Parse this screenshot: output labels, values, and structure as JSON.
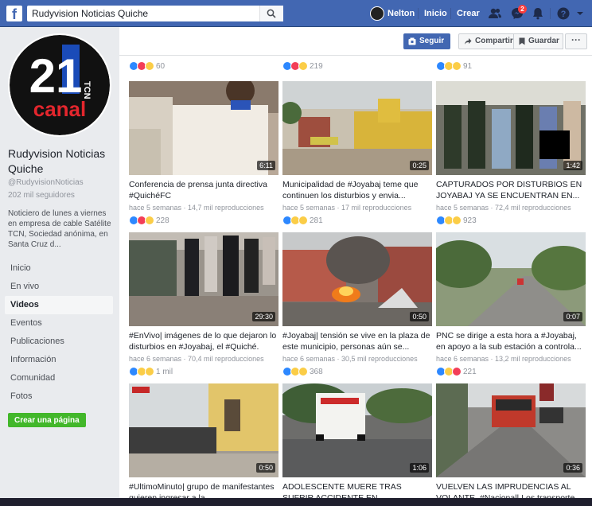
{
  "topbar": {
    "search_value": "Rudyvision Noticias Quiche",
    "user_name": "Nelton",
    "home_label": "Inicio",
    "create_label": "Crear",
    "messages_badge": "2",
    "brand_color": "#4267b2"
  },
  "sidebar": {
    "logo_number": "21",
    "logo_small": "TCN",
    "logo_word": "canal",
    "page_name": "Rudyvision Noticias Quiche",
    "handle": "@RudyvisionNoticias",
    "followers": "202 mil seguidores",
    "description": "Noticiero de lunes a viernes en empresa de cable Satélite TCN, Sociedad anónima, en Santa Cruz d...",
    "nav": [
      "Inicio",
      "En vivo",
      "Videos",
      "Eventos",
      "Publicaciones",
      "Información",
      "Comunidad",
      "Fotos"
    ],
    "active_nav": "Videos",
    "create_page": "Crear una página"
  },
  "actions": {
    "follow": "Seguir",
    "share": "Compartir",
    "save": "Guardar",
    "more": "···"
  },
  "top_counts": [
    "60",
    "219",
    "91"
  ],
  "videos": [
    {
      "title": "Conferencia de prensa junta directiva #QuichéFC",
      "meta": "hace 5 semanas · 14,7 mil reproducciones",
      "duration": "6:11",
      "reactions": [
        "like",
        "love",
        "haha"
      ],
      "count": "228"
    },
    {
      "title": "Municipalidad de #Joyabaj teme que continuen los disturbios y envia...",
      "meta": "hace 5 semanas · 17 mil reproducciones",
      "duration": "0:25",
      "reactions": [
        "like",
        "haha",
        "sad"
      ],
      "count": "281"
    },
    {
      "title": "CAPTURADOS POR DISTURBIOS EN JOYABAJ YA SE ENCUENTRAN EN...",
      "meta": "hace 5 semanas · 72,4 mil reproducciones",
      "duration": "1:42",
      "reactions": [
        "like",
        "sad",
        "wow"
      ],
      "count": "923"
    },
    {
      "title": "#EnVivo| imágenes de lo que dejaron lo disturbios en #Joyabaj, el #Quiché.",
      "meta": "hace 6 semanas · 70,4 mil reproducciones",
      "duration": "29:30",
      "reactions": [
        "like",
        "sad",
        "wow"
      ],
      "count": "1 mil"
    },
    {
      "title": "#Joyabaj| tensión se vive en la plaza de este municipio, personas aún se...",
      "meta": "hace 6 semanas · 30,5 mil reproducciones",
      "duration": "0:50",
      "reactions": [
        "like",
        "sad",
        "wow"
      ],
      "count": "368"
    },
    {
      "title": "PNC se dirige a esta hora a #Joyabaj, en apoyo a la sub estación a controla...",
      "meta": "hace 6 semanas · 13,2 mil reproducciones",
      "duration": "0:07",
      "reactions": [
        "like",
        "haha",
        "love"
      ],
      "count": "221"
    },
    {
      "title": "#UltimoMinuto| grupo de manifestantes quieren ingresar a la...",
      "meta": "",
      "duration": "0:50",
      "reactions": [],
      "count": ""
    },
    {
      "title": "ADOLESCENTE MUERE TRAS SUFRIR ACCIDENTE EN MOTOCICLETA...",
      "meta": "",
      "duration": "1:06",
      "reactions": [],
      "count": ""
    },
    {
      "title": "VUELVEN LAS IMPRUDENCIAS AL VOLANTE, #Nacional| Los transporte...",
      "meta": "",
      "duration": "0:36",
      "reactions": [],
      "count": ""
    }
  ]
}
